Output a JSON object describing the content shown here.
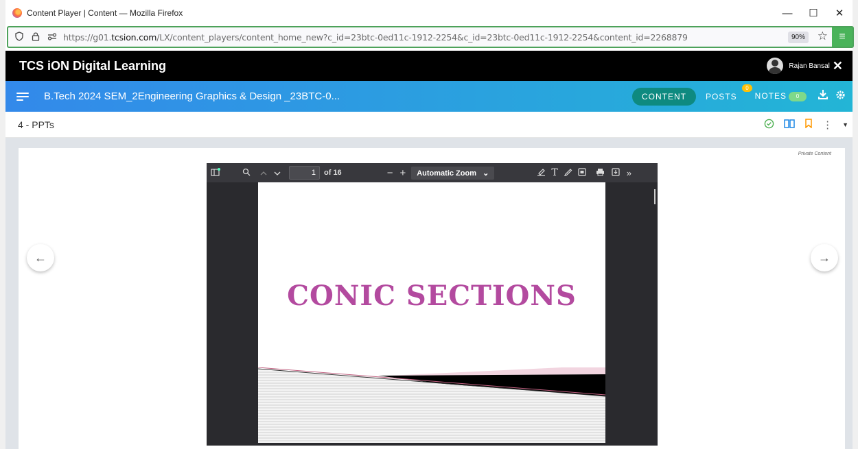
{
  "window": {
    "title": "Content Player | Content — Mozilla Firefox",
    "controls": {
      "minimize": "—",
      "maximize": "☐",
      "close": "✕"
    }
  },
  "urlbar": {
    "prefix": "https://g01.",
    "domain": "tcsion.com",
    "path": "/LX/content_players/content_home_new?c_id=23btc-0ed11c-1912-2254&c_id=23btc-0ed11c-1912-2254&content_id=2268879",
    "zoom": "90%"
  },
  "app": {
    "brand": "TCS iON Digital Learning",
    "user_name": "Rajan Bansal"
  },
  "course": {
    "title": "B.Tech 2024 SEM_2Engineering Graphics & Design _23BTC-0...",
    "nav": {
      "content": "CONTENT",
      "posts": "POSTS",
      "posts_badge": "0",
      "notes": "NOTES",
      "notes_badge": "0"
    }
  },
  "section": {
    "title": "4 - PPTs"
  },
  "viewer": {
    "private_label": "Private Content",
    "page_current": "1",
    "page_total": "of 16",
    "zoom_mode": "Automatic Zoom",
    "slide_title": "CONIC SECTIONS"
  },
  "colors": {
    "accent_green": "#4ab35a",
    "course_gradient_start": "#3389ea",
    "course_gradient_end": "#23b5d6",
    "slide_title": "#b34a9f"
  }
}
